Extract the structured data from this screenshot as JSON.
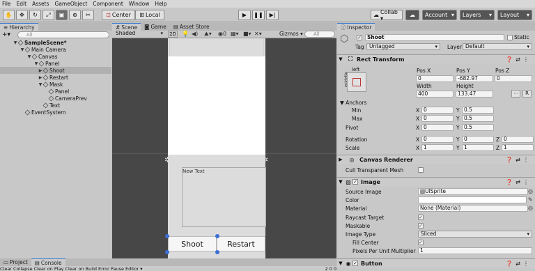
{
  "menu": [
    "File",
    "Edit",
    "Assets",
    "GameObject",
    "Component",
    "Window",
    "Help"
  ],
  "toolbar": {
    "tools": [
      "hand-tool",
      "move-tool",
      "rotate-tool",
      "scale-tool",
      "rect-tool",
      "transform-tool",
      "custom-tool"
    ],
    "pivot_center": "Center",
    "pivot_local": "Local",
    "collab": "Collab ▾",
    "account": "Account",
    "layers": "Layers",
    "layout": "Layout"
  },
  "hierarchy": {
    "tab": "Hierarchy",
    "search_placeholder": "All",
    "items": [
      {
        "label": "SampleScene*",
        "bold": true
      },
      {
        "label": "Main Camera"
      },
      {
        "label": "Canvas"
      },
      {
        "label": "Panel"
      },
      {
        "label": "Shoot",
        "selected": true
      },
      {
        "label": "Restart"
      },
      {
        "label": "Mask"
      },
      {
        "label": "Panel"
      },
      {
        "label": "CameraPrev"
      },
      {
        "label": "Text"
      },
      {
        "label": "EventSystem"
      }
    ]
  },
  "scene": {
    "tabs": [
      "Scene",
      "Game",
      "Asset Store"
    ],
    "shading": "Shaded",
    "mode_2d": "2D",
    "gizmos": "Gizmos",
    "search_placeholder": "All",
    "new_text": "New Text",
    "shoot_btn": "Shoot",
    "restart_btn": "Restart"
  },
  "bottom_tabs": [
    "Project",
    "Console"
  ],
  "console_buttons": [
    "Clear",
    "Collapse",
    "Clear on Play",
    "Clear on Build",
    "Error Pause",
    "Editor ▾"
  ],
  "console_counts": [
    "2",
    "0",
    "0"
  ],
  "inspector": {
    "tab": "Inspector",
    "name": "Shoot",
    "static": "Static",
    "tag_label": "Tag",
    "tag": "Untagged",
    "layer_label": "Layer",
    "layer": "Default",
    "rect_transform": {
      "title": "Rect Transform",
      "anchor_preset": "left",
      "side_label": "middle",
      "pos_labels": [
        "Pos X",
        "Pos Y",
        "Pos Z"
      ],
      "pos": [
        "0",
        "-682.97",
        "0"
      ],
      "size_labels": [
        "Width",
        "Height"
      ],
      "size": [
        "400",
        "133.47"
      ],
      "r_button": "R",
      "anchors": "Anchors",
      "min": "Min",
      "min_x": "0",
      "min_y": "0.5",
      "max": "Max",
      "max_x": "0",
      "max_y": "0.5",
      "pivot": "Pivot",
      "pivot_x": "0",
      "pivot_y": "0.5",
      "rotation": "Rotation",
      "rot": [
        "0",
        "0",
        "0"
      ],
      "scale": "Scale",
      "scl": [
        "1",
        "1",
        "1"
      ],
      "axes": [
        "X",
        "Y",
        "Z"
      ]
    },
    "canvas_renderer": {
      "title": "Canvas Renderer",
      "cull": "Cull Transparent Mesh"
    },
    "image": {
      "title": "Image",
      "source_image_label": "Source Image",
      "source_image": "UISprite",
      "color_label": "Color",
      "material_label": "Material",
      "material": "None (Material)",
      "raycast": "Raycast Target",
      "maskable": "Maskable",
      "image_type_label": "Image Type",
      "image_type": "Sliced",
      "fill_center": "Fill Center",
      "ppu_label": "Pixels Per Unit Multiplier",
      "ppu": "1"
    },
    "button": {
      "title": "Button"
    }
  }
}
